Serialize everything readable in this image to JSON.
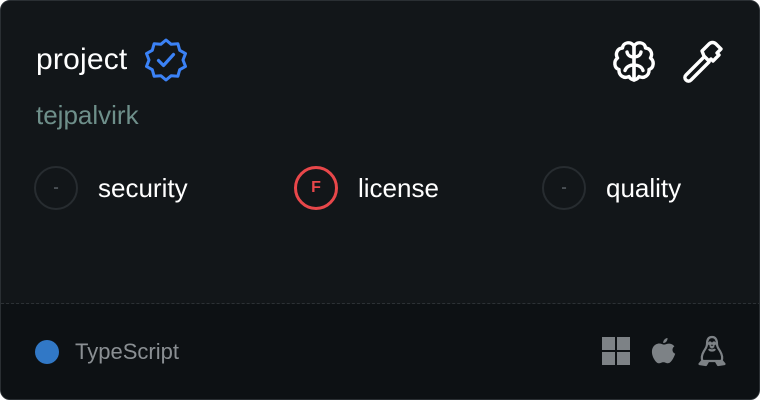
{
  "card": {
    "title": "project",
    "owner": "tejpalvirk",
    "verified": true
  },
  "top_actions": [
    {
      "icon": "brain-icon"
    },
    {
      "icon": "hammer-icon"
    }
  ],
  "metrics": [
    {
      "name": "security",
      "grade": "-",
      "status": "neutral"
    },
    {
      "name": "license",
      "grade": "F",
      "status": "fail"
    },
    {
      "name": "quality",
      "grade": "-",
      "status": "neutral"
    }
  ],
  "footer": {
    "language": "TypeScript",
    "language_color": "#3178c6",
    "platforms": [
      "windows-icon",
      "apple-icon",
      "linux-icon"
    ]
  },
  "colors": {
    "card_background": "#121619",
    "footer_background": "#0d1114",
    "verified_blue": "#3b82f6",
    "fail_red": "#e8474a",
    "owner_text": "#6e8f8a"
  }
}
